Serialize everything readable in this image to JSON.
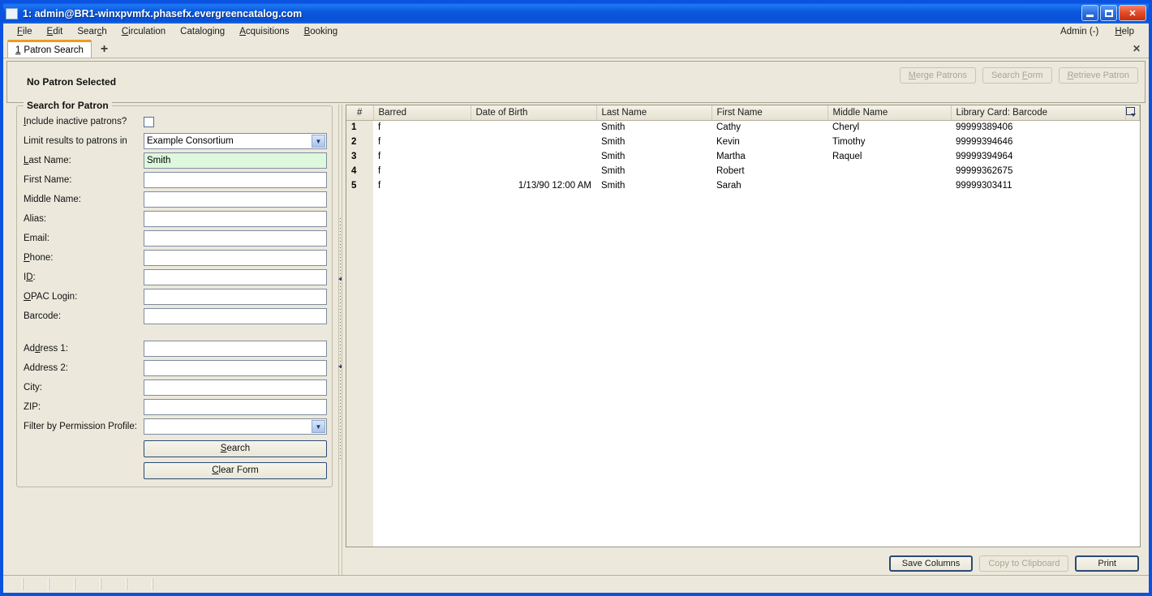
{
  "window": {
    "title": "1: admin@BR1-winxpvmfx.phasefx.evergreencatalog.com",
    "minimize_label": "Minimize",
    "maximize_label": "Maximize",
    "close_label": "✕"
  },
  "menubar": {
    "items": [
      {
        "label": "File",
        "accel": "F"
      },
      {
        "label": "Edit",
        "accel": "E"
      },
      {
        "label": "Search",
        "accel": "c"
      },
      {
        "label": "Circulation",
        "accel": "C"
      },
      {
        "label": "Cataloging",
        "accel": "g"
      },
      {
        "label": "Acquisitions",
        "accel": "A"
      },
      {
        "label": "Booking",
        "accel": "B"
      }
    ],
    "admin_label": "Admin (-)",
    "help_label": "Help"
  },
  "tabs": {
    "active": {
      "number": "1",
      "label": "Patron Search"
    },
    "add_label": "+",
    "close_label": "✕"
  },
  "patron_bar": {
    "title": "No Patron Selected",
    "buttons": [
      {
        "label": "Merge Patrons",
        "enabled": false
      },
      {
        "label": "Search Form",
        "enabled": false
      },
      {
        "label": "Retrieve Patron",
        "enabled": false
      }
    ]
  },
  "search_form": {
    "legend": "Search for Patron",
    "include_inactive_label": "Include inactive patrons?",
    "include_inactive_checked": false,
    "limit_results_label": "Limit results to patrons in",
    "limit_results_value": "Example Consortium",
    "fields": [
      {
        "label": "Last Name:",
        "value": "Smith",
        "active": true
      },
      {
        "label": "First Name:",
        "value": "",
        "active": false
      },
      {
        "label": "Middle Name:",
        "value": "",
        "active": false
      },
      {
        "label": "Alias:",
        "value": "",
        "active": false
      },
      {
        "label": "Email:",
        "value": "",
        "active": false
      },
      {
        "label": "Phone:",
        "value": "",
        "active": false
      },
      {
        "label": "ID:",
        "value": "",
        "active": false
      },
      {
        "label": "OPAC Login:",
        "value": "",
        "active": false
      },
      {
        "label": "Barcode:",
        "value": "",
        "active": false
      }
    ],
    "address_fields": [
      {
        "label": "Address 1:",
        "value": ""
      },
      {
        "label": "Address 2:",
        "value": ""
      },
      {
        "label": "City:",
        "value": ""
      },
      {
        "label": "ZIP:",
        "value": ""
      }
    ],
    "permission_profile_label": "Filter by Permission Profile:",
    "permission_profile_value": "",
    "search_button": "Search",
    "clear_button": "Clear Form"
  },
  "results": {
    "columns": [
      "#",
      "Barred",
      "Date of Birth",
      "Last Name",
      "First Name",
      "Middle Name",
      "Library Card: Barcode"
    ],
    "rows": [
      {
        "num": "1",
        "barred": "f",
        "dob": "",
        "last": "Smith",
        "first": "Cathy",
        "middle": "Cheryl",
        "barcode": "99999389406"
      },
      {
        "num": "2",
        "barred": "f",
        "dob": "",
        "last": "Smith",
        "first": "Kevin",
        "middle": "Timothy",
        "barcode": "99999394646"
      },
      {
        "num": "3",
        "barred": "f",
        "dob": "",
        "last": "Smith",
        "first": "Martha",
        "middle": "Raquel",
        "barcode": "99999394964"
      },
      {
        "num": "4",
        "barred": "f",
        "dob": "",
        "last": "Smith",
        "first": "Robert",
        "middle": "",
        "barcode": "99999362675"
      },
      {
        "num": "5",
        "barred": "f",
        "dob": "1/13/90 12:00 AM",
        "last": "Smith",
        "first": "Sarah",
        "middle": "",
        "barcode": "99999303411"
      }
    ],
    "footer_buttons": [
      {
        "label": "Save Columns",
        "enabled": true,
        "default": true
      },
      {
        "label": "Copy to Clipboard",
        "enabled": false,
        "default": false
      },
      {
        "label": "Print",
        "enabled": true,
        "default": true
      }
    ]
  },
  "colors": {
    "titlebar": "#0a51d6",
    "panel": "#ece9dc",
    "active_field": "#ddf8dd",
    "tab_accent": "#f09a20"
  }
}
